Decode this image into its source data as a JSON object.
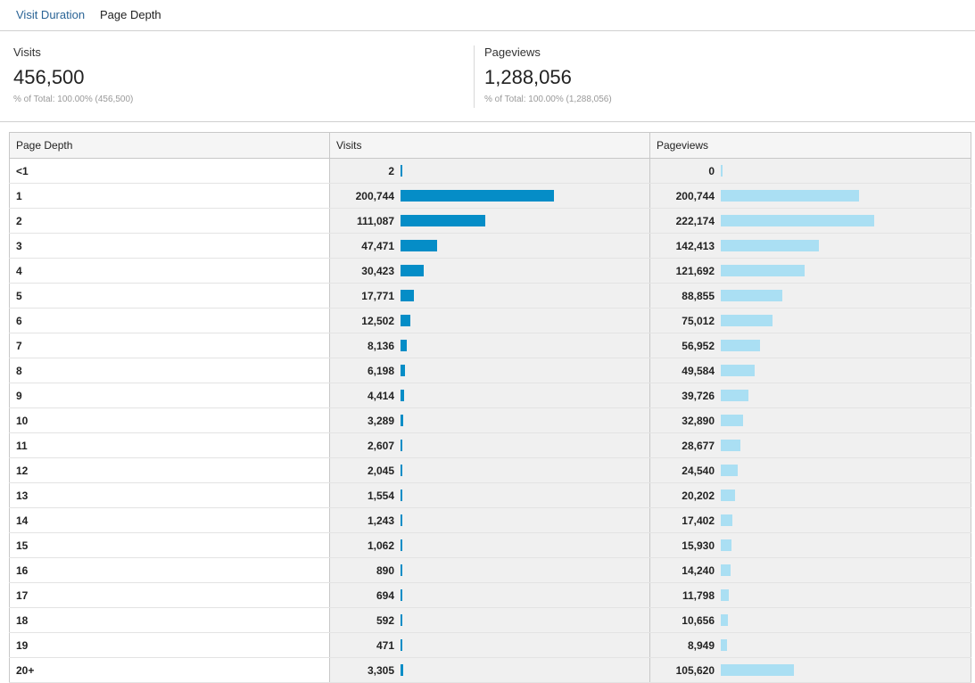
{
  "tabs": {
    "visit_duration": "Visit Duration",
    "page_depth": "Page Depth"
  },
  "summary": {
    "visits": {
      "label": "Visits",
      "value": "456,500",
      "total": "% of Total: 100.00% (456,500)"
    },
    "pageviews": {
      "label": "Pageviews",
      "value": "1,288,056",
      "total": "% of Total: 100.00% (1,288,056)"
    }
  },
  "table": {
    "headers": [
      "Page Depth",
      "Visits",
      "Pageviews"
    ],
    "rows": [
      {
        "depth": "<1",
        "visits": "2",
        "pageviews": "0"
      },
      {
        "depth": "1",
        "visits": "200,744",
        "pageviews": "200,744"
      },
      {
        "depth": "2",
        "visits": "111,087",
        "pageviews": "222,174"
      },
      {
        "depth": "3",
        "visits": "47,471",
        "pageviews": "142,413"
      },
      {
        "depth": "4",
        "visits": "30,423",
        "pageviews": "121,692"
      },
      {
        "depth": "5",
        "visits": "17,771",
        "pageviews": "88,855"
      },
      {
        "depth": "6",
        "visits": "12,502",
        "pageviews": "75,012"
      },
      {
        "depth": "7",
        "visits": "8,136",
        "pageviews": "56,952"
      },
      {
        "depth": "8",
        "visits": "6,198",
        "pageviews": "49,584"
      },
      {
        "depth": "9",
        "visits": "4,414",
        "pageviews": "39,726"
      },
      {
        "depth": "10",
        "visits": "3,289",
        "pageviews": "32,890"
      },
      {
        "depth": "11",
        "visits": "2,607",
        "pageviews": "28,677"
      },
      {
        "depth": "12",
        "visits": "2,045",
        "pageviews": "24,540"
      },
      {
        "depth": "13",
        "visits": "1,554",
        "pageviews": "20,202"
      },
      {
        "depth": "14",
        "visits": "1,243",
        "pageviews": "17,402"
      },
      {
        "depth": "15",
        "visits": "1,062",
        "pageviews": "15,930"
      },
      {
        "depth": "16",
        "visits": "890",
        "pageviews": "14,240"
      },
      {
        "depth": "17",
        "visits": "694",
        "pageviews": "11,798"
      },
      {
        "depth": "18",
        "visits": "592",
        "pageviews": "10,656"
      },
      {
        "depth": "19",
        "visits": "471",
        "pageviews": "8,949"
      },
      {
        "depth": "20+",
        "visits": "3,305",
        "pageviews": "105,620"
      }
    ]
  },
  "colors": {
    "link": "#2a6496",
    "visits_bar": "#058dc7",
    "pageviews_bar": "#aadff3"
  }
}
